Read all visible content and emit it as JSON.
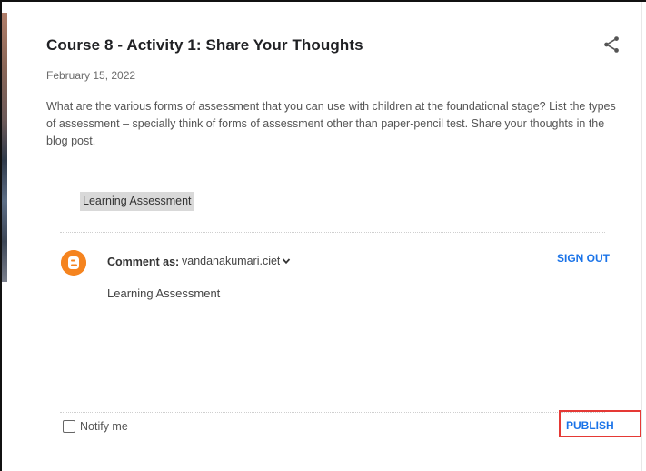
{
  "post": {
    "title": "Course 8 - Activity 1: Share Your Thoughts",
    "date": "February 15, 2022",
    "body": "What are the various forms of assessment that you can use with children at the foundational stage? List the types of assessment – specially think of forms of assessment other than paper-pencil test. Share your thoughts in the blog post.",
    "label": "Learning Assessment"
  },
  "comment": {
    "comment_as_label": "Comment as:",
    "account": "vandanakumari.ciet@",
    "sign_out_label": "SIGN OUT",
    "text": "Learning Assessment",
    "notify_label": "Notify me",
    "notify_checked": false,
    "publish_label": "PUBLISH"
  },
  "icons": {
    "share": "share-icon",
    "avatar": "blogger-icon",
    "dropdown": "chevron-down-icon"
  },
  "colors": {
    "accent": "#1a73e8",
    "avatar": "#f5841f",
    "highlight": "#e53935"
  }
}
